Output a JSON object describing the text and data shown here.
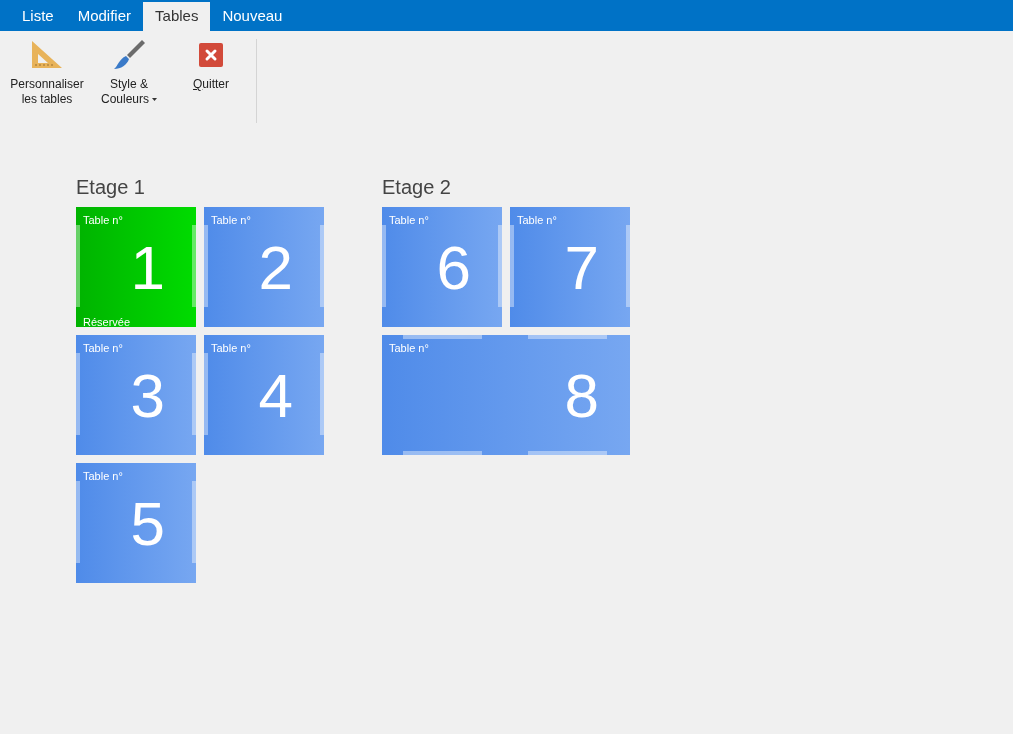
{
  "tabs": [
    {
      "label": "Liste",
      "selected": false
    },
    {
      "label": "Modifier",
      "selected": false
    },
    {
      "label": "Tables",
      "selected": true
    },
    {
      "label": "Nouveau",
      "selected": false
    }
  ],
  "ribbon": [
    {
      "kind": "ruler",
      "label": "Personnaliser les tables",
      "dropdown": false,
      "underline_first": false
    },
    {
      "kind": "brush",
      "label": "Style & Couleurs",
      "dropdown": true,
      "underline_first": false
    },
    {
      "kind": "quit",
      "label": "Quitter",
      "dropdown": false,
      "underline_first": true
    }
  ],
  "floors": [
    {
      "title": "Etage 1",
      "tables": [
        {
          "caption": "Table n°",
          "number": "1",
          "reserved": true,
          "status_label": "Réservée",
          "wide": false
        },
        {
          "caption": "Table n°",
          "number": "2",
          "reserved": false,
          "wide": false
        },
        {
          "caption": "Table n°",
          "number": "3",
          "reserved": false,
          "wide": false
        },
        {
          "caption": "Table n°",
          "number": "4",
          "reserved": false,
          "wide": false
        },
        {
          "caption": "Table n°",
          "number": "5",
          "reserved": false,
          "wide": false
        }
      ]
    },
    {
      "title": "Etage 2",
      "tables": [
        {
          "caption": "Table n°",
          "number": "6",
          "reserved": false,
          "wide": false
        },
        {
          "caption": "Table n°",
          "number": "7",
          "reserved": false,
          "wide": false
        },
        {
          "caption": "Table n°",
          "number": "8",
          "reserved": false,
          "wide": true
        }
      ]
    }
  ]
}
